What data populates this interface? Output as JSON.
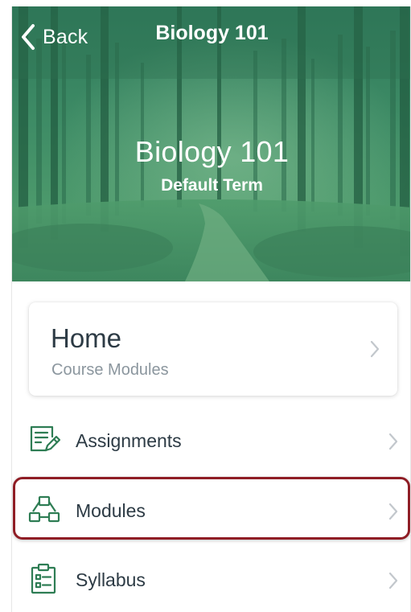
{
  "nav": {
    "back_label": "Back",
    "title": "Biology 101"
  },
  "course": {
    "name": "Biology 101",
    "term": "Default Term"
  },
  "home_card": {
    "title": "Home",
    "subtitle": "Course Modules"
  },
  "menu": {
    "items": [
      {
        "label": "Assignments",
        "icon": "assignments-icon"
      },
      {
        "label": "Modules",
        "icon": "modules-icon",
        "highlighted": true
      },
      {
        "label": "Syllabus",
        "icon": "syllabus-icon"
      }
    ]
  },
  "colors": {
    "banner_green": "#3f8d66",
    "icon_green": "#2e7d54",
    "text_dark": "#2d3b45",
    "text_muted": "#8b969e",
    "chevron_gray": "#c2c7cc",
    "highlight_red": "#8f1d25"
  }
}
